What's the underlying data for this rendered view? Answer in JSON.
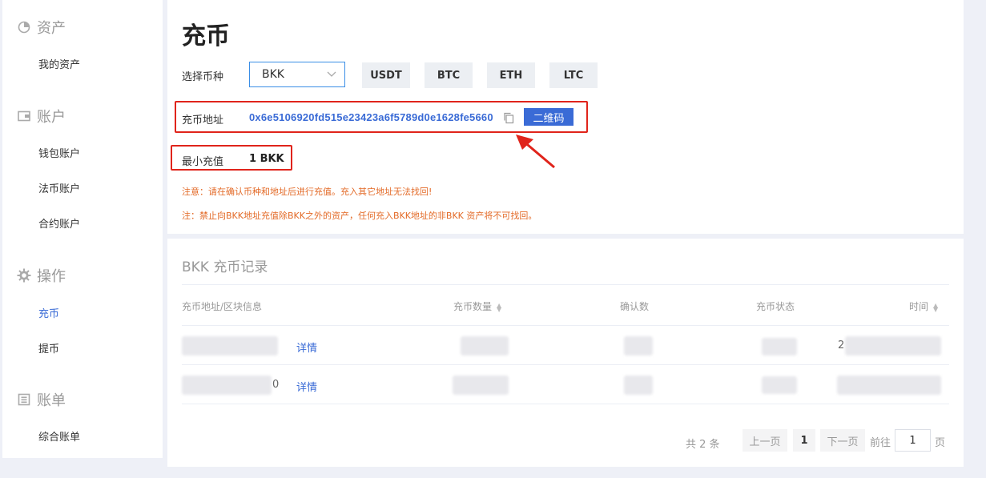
{
  "sidebar": {
    "groups": [
      {
        "title": "资产",
        "icon": "pie-chart-icon",
        "items": [
          "我的资产"
        ]
      },
      {
        "title": "账户",
        "icon": "wallet-icon",
        "items": [
          "钱包账户",
          "法币账户",
          "合约账户"
        ]
      },
      {
        "title": "操作",
        "icon": "gear-icon",
        "items": [
          "充币",
          "提币"
        ]
      },
      {
        "title": "账单",
        "icon": "bill-icon",
        "items": [
          "综合账单"
        ]
      }
    ],
    "active_item": "充币"
  },
  "deposit": {
    "title": "充币",
    "select_label": "选择币种",
    "selected_coin": "BKK",
    "quick_coins": [
      "USDT",
      "BTC",
      "ETH",
      "LTC"
    ],
    "address_label": "充币地址",
    "address": "0x6e5106920fd515e23423a6f5789d0e1628fe5660",
    "qr_button": "二维码",
    "min_label": "最小充值",
    "min_value": "1 BKK",
    "note1": "注意：请在确认币种和地址后进行充值。充入其它地址无法找回!",
    "note2": "注：禁止向BKK地址充值除BKK之外的资产，任何充入BKK地址的非BKK 资产将不可找回。"
  },
  "records": {
    "title": "BKK 充币记录",
    "columns": [
      "充币地址/区块信息",
      "充币数量",
      "确认数",
      "充币状态",
      "时间"
    ],
    "rows": [
      {
        "detail": "详情",
        "address_visible": "",
        "time_visible": "2"
      },
      {
        "detail": "详情",
        "address_visible": "0",
        "time_visible": ""
      }
    ]
  },
  "pagination": {
    "total": "共 2 条",
    "prev": "上一页",
    "current": "1",
    "next": "下一页",
    "goto_label": "前往",
    "goto_value": "1",
    "page_suffix": "页"
  },
  "colors": {
    "accent": "#3a6bd6",
    "highlight": "#e0241b",
    "warning": "#e36a27"
  }
}
